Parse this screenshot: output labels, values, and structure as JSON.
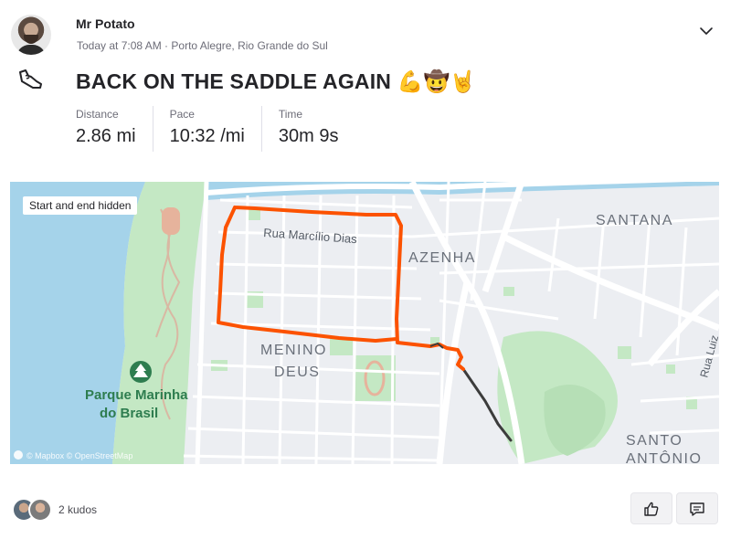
{
  "athlete": {
    "name": "Mr Potato",
    "timestamp_location": "Today at 7:08 AM · Porto Alegre, Rio Grande do Sul"
  },
  "activity": {
    "title": "BACK ON THE SADDLE AGAIN",
    "title_emoji": "💪🤠🤘",
    "type_icon": "running-shoe-icon"
  },
  "stats": [
    {
      "label": "Distance",
      "value": "2.86 mi"
    },
    {
      "label": "Pace",
      "value": "10:32 /mi"
    },
    {
      "label": "Time",
      "value": "30m 9s"
    }
  ],
  "map": {
    "badge": "Start and end hidden",
    "attribution": "© Mapbox © OpenStreetMap",
    "labels": {
      "street": "Rua Marcílio Dias",
      "azenha": "AZENHA",
      "santana": "SANTANA",
      "menino": "MENINO",
      "deus": "DEUS",
      "parque1": "Parque Marinha",
      "parque2": "do Brasil",
      "santo": "SANTO",
      "antonio": "ANTÔNIO",
      "rua_luiz": "Rua Luiz"
    },
    "colors": {
      "route": "#fc5200",
      "hidden_route": "#3c3c3c",
      "water": "#a5d3ea",
      "park": "#c4e8c4"
    }
  },
  "social": {
    "kudos_text": "2 kudos"
  }
}
